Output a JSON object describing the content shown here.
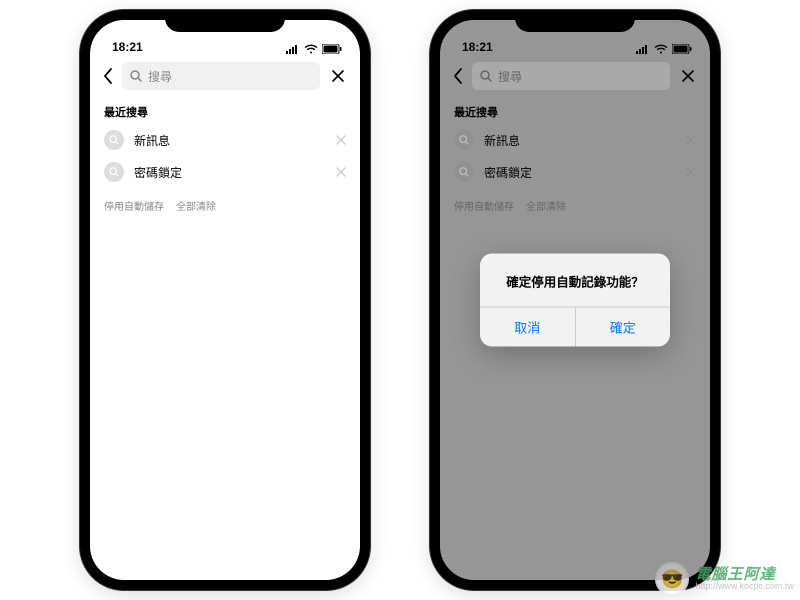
{
  "statusbar": {
    "time": "18:21"
  },
  "search": {
    "placeholder": "搜尋"
  },
  "recent": {
    "title": "最近搜尋",
    "items": [
      {
        "label": "新訊息"
      },
      {
        "label": "密碼鎖定"
      }
    ],
    "actions": {
      "disable_autosave": "停用自動儲存",
      "clear_all": "全部清除"
    }
  },
  "alert": {
    "title": "確定停用自動記錄功能？",
    "cancel": "取消",
    "confirm": "確定"
  },
  "watermark": {
    "title": "電腦王阿達",
    "url": "http://www.kocpc.com.tw"
  }
}
